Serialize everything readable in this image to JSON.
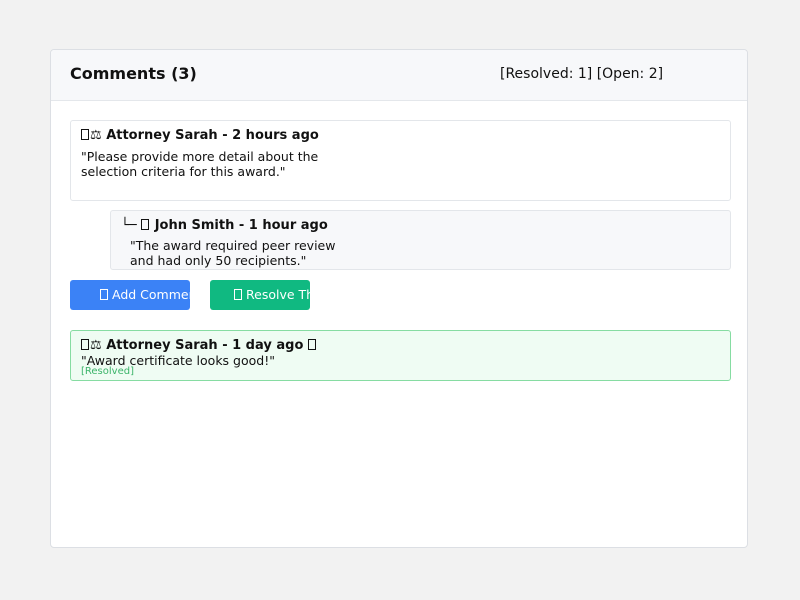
{
  "header": {
    "title": "Comments (3)",
    "counts": "[Resolved: 1] [Open: 2]"
  },
  "comments": [
    {
      "icon": "scales-icon",
      "prefix": "⚖",
      "author_line": "Attorney Sarah - 2 hours ago",
      "body": "\"Please provide more detail about the\nselection criteria for this award.\""
    },
    {
      "icon": "user-icon",
      "prefix": "└─",
      "author_line": "John Smith - 1 hour ago",
      "body": "\"The award required peer review\n and had only 50 recipients.\""
    },
    {
      "icon": "scales-icon",
      "prefix": "⚖",
      "author_line": "Attorney Sarah - 1 day ago",
      "trailing_icon": "check-icon",
      "body": "\"Award certificate looks good!\"",
      "status": "[Resolved]"
    }
  ],
  "actions": {
    "add_label": "Add Comment",
    "resolve_label": "Resolve Thread"
  },
  "colors": {
    "add_button": "#3b82f6",
    "resolve_button": "#10b981",
    "resolved_border": "#86dca2",
    "resolved_bg": "#effcf3",
    "resolved_text": "#3cb46a"
  }
}
